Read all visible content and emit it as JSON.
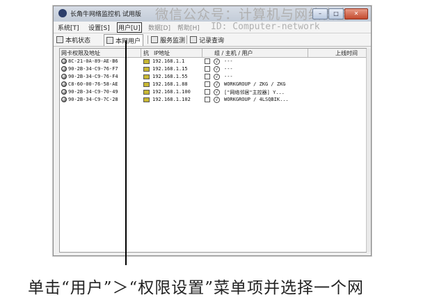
{
  "window": {
    "title": "长角牛网络监控机 试用版",
    "watermark_text": "微信公众号：计算机与网络安全",
    "controls": {
      "minimize": "–",
      "maximize": "□",
      "close": "✕"
    }
  },
  "menubar": {
    "items": [
      {
        "label": "系统[T]"
      },
      {
        "label": "设置[S]"
      },
      {
        "label": "用户[U]"
      },
      {
        "label": "数据[D]"
      },
      {
        "label": "帮助[H]"
      }
    ],
    "watermark_text": "ID: Computer-network"
  },
  "tabs": [
    {
      "label": "本机状态"
    },
    {
      "label": "本网用户"
    },
    {
      "label": "服务监测"
    },
    {
      "label": "记录查询"
    }
  ],
  "table": {
    "columns": [
      "网卡权限及地址",
      "抗",
      "IP地址",
      "",
      "组 / 主机 / 用户",
      "上线时间"
    ],
    "rows": [
      {
        "mac": "8C-21-0A-89-AE-B6",
        "ip": "192.168.1.1",
        "status": "√",
        "group": "---"
      },
      {
        "mac": "90-2B-34-C9-76-F7",
        "ip": "192.168.1.15",
        "status": "√",
        "group": "---"
      },
      {
        "mac": "90-2B-34-C9-76-F4",
        "ip": "192.168.1.55",
        "status": "√",
        "group": "---"
      },
      {
        "mac": "C8-60-00-76-58-AE",
        "ip": "192.168.1.88",
        "status": "√",
        "group": "WORKGROUP / ZKG / ZKG"
      },
      {
        "mac": "90-2B-34-C9-70-49",
        "ip": "192.168.1.100",
        "status": "√",
        "group": "[\"网络邻居\"主控器] Y..."
      },
      {
        "mac": "90-2B-34-C9-7C-28",
        "ip": "192.168.1.102",
        "status": "√",
        "group": "WORKGROUP / 4LSQBIK..."
      }
    ]
  },
  "caption": "单击“用户”＞“权限设置”菜单项并选择一个网",
  "colors": {
    "accent_box": "#333333",
    "monitor_icon": "#c9b833",
    "close_button": "#c34a2e"
  }
}
